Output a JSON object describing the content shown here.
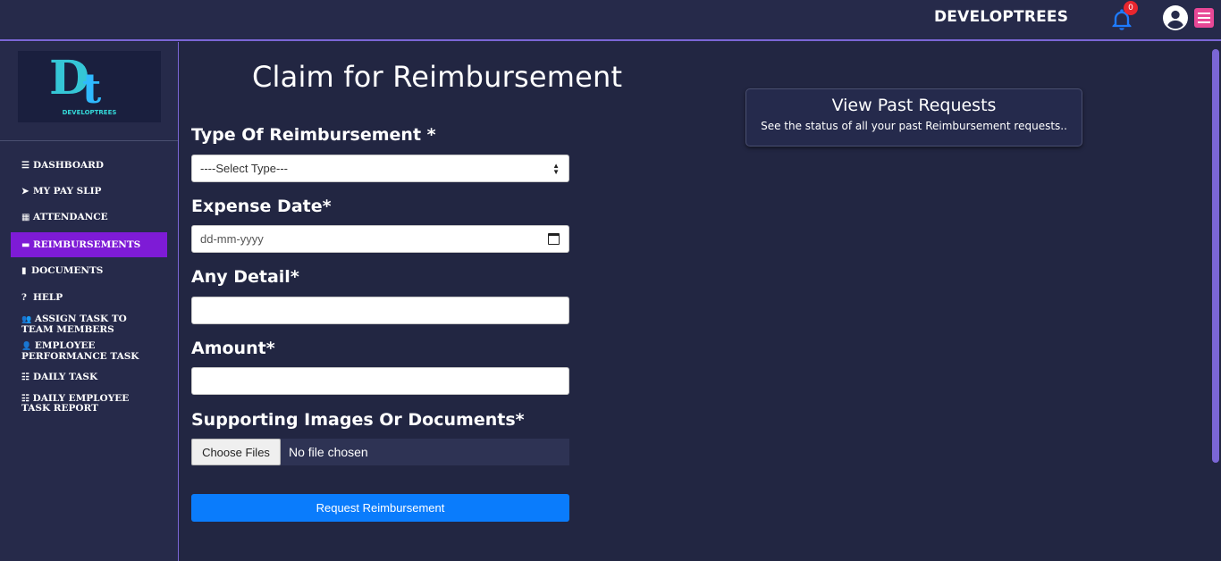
{
  "topbar": {
    "brand": "DEVELOPTREES",
    "notification_count": "0"
  },
  "sidebar": {
    "logo_text": "DEVELOPTREES",
    "items": [
      {
        "icon": "bars-icon",
        "label": "DASHBOARD",
        "active": false
      },
      {
        "icon": "paper-plane-icon",
        "label": "MY PAY SLIP",
        "active": false
      },
      {
        "icon": "calendar-icon",
        "label": "ATTENDANCE",
        "active": false
      },
      {
        "icon": "credit-card-icon",
        "label": "REIMBURSEMENTS",
        "active": true
      },
      {
        "icon": "file-icon",
        "label": "DOCUMENTS",
        "active": false
      },
      {
        "icon": "question-circle-icon",
        "label": "HELP",
        "active": false
      },
      {
        "icon": "users-icon",
        "label": "ASSIGN TASK TO TEAM MEMBERS",
        "active": false
      },
      {
        "icon": "user-edit-icon",
        "label": "EMPLOYEE PERFORMANCE TASK",
        "active": false
      },
      {
        "icon": "list-icon",
        "label": "DAILY TASK",
        "active": false
      },
      {
        "icon": "list-icon",
        "label": "DAILY EMPLOYEE TASK REPORT",
        "active": false
      }
    ],
    "active_color": "#7e1bd6"
  },
  "main": {
    "title": "Claim for Reimbursement",
    "form": {
      "type_label": "Type Of Reimbursement *",
      "type_value": "----Select Type---",
      "date_label": "Expense Date*",
      "date_placeholder": "dd-mm-yyyy",
      "detail_label": "Any Detail*",
      "detail_value": "",
      "amount_label": "Amount*",
      "amount_value": "",
      "docs_label": "Supporting Images Or Documents*",
      "choose_files": "Choose Files",
      "no_file": "No file chosen",
      "submit": "Request Reimbursement"
    },
    "past_requests": {
      "title": "View Past Requests",
      "subtitle": "See the status of all your past Reimbursement requests.."
    }
  },
  "colors": {
    "background": "#222642",
    "accent": "#7b66d6",
    "primary_button": "#0a7cfc"
  }
}
